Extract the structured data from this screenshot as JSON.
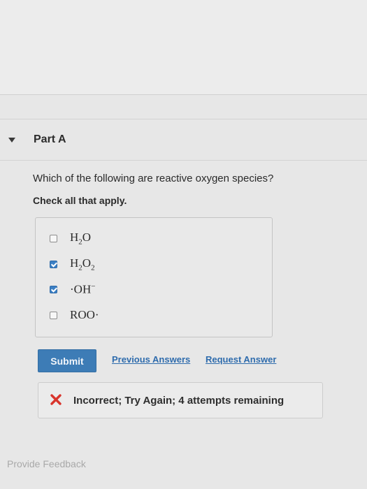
{
  "part": {
    "title": "Part A"
  },
  "question": {
    "prompt": "Which of the following are reactive oxygen species?",
    "instruction": "Check all that apply."
  },
  "choices": [
    {
      "label_parts": [
        "H",
        "2",
        "O"
      ],
      "checked": false
    },
    {
      "label_parts": [
        "H",
        "2",
        "O",
        "2"
      ],
      "checked": true
    },
    {
      "label_parts": [
        "·OH",
        "−"
      ],
      "checked": true
    },
    {
      "label_parts": [
        "ROO·"
      ],
      "checked": false
    }
  ],
  "actions": {
    "submit_label": "Submit",
    "previous_answers_label": "Previous Answers",
    "request_answer_label": "Request Answer"
  },
  "feedback": {
    "message": "Incorrect; Try Again; 4 attempts remaining",
    "icon": "x-icon",
    "icon_color": "#d8342c"
  },
  "footer": {
    "provide_feedback_label": "Provide Feedback"
  },
  "colors": {
    "submit_bg": "#3d7cb6",
    "link": "#2f6cad",
    "checked": "#3b7fc4"
  }
}
